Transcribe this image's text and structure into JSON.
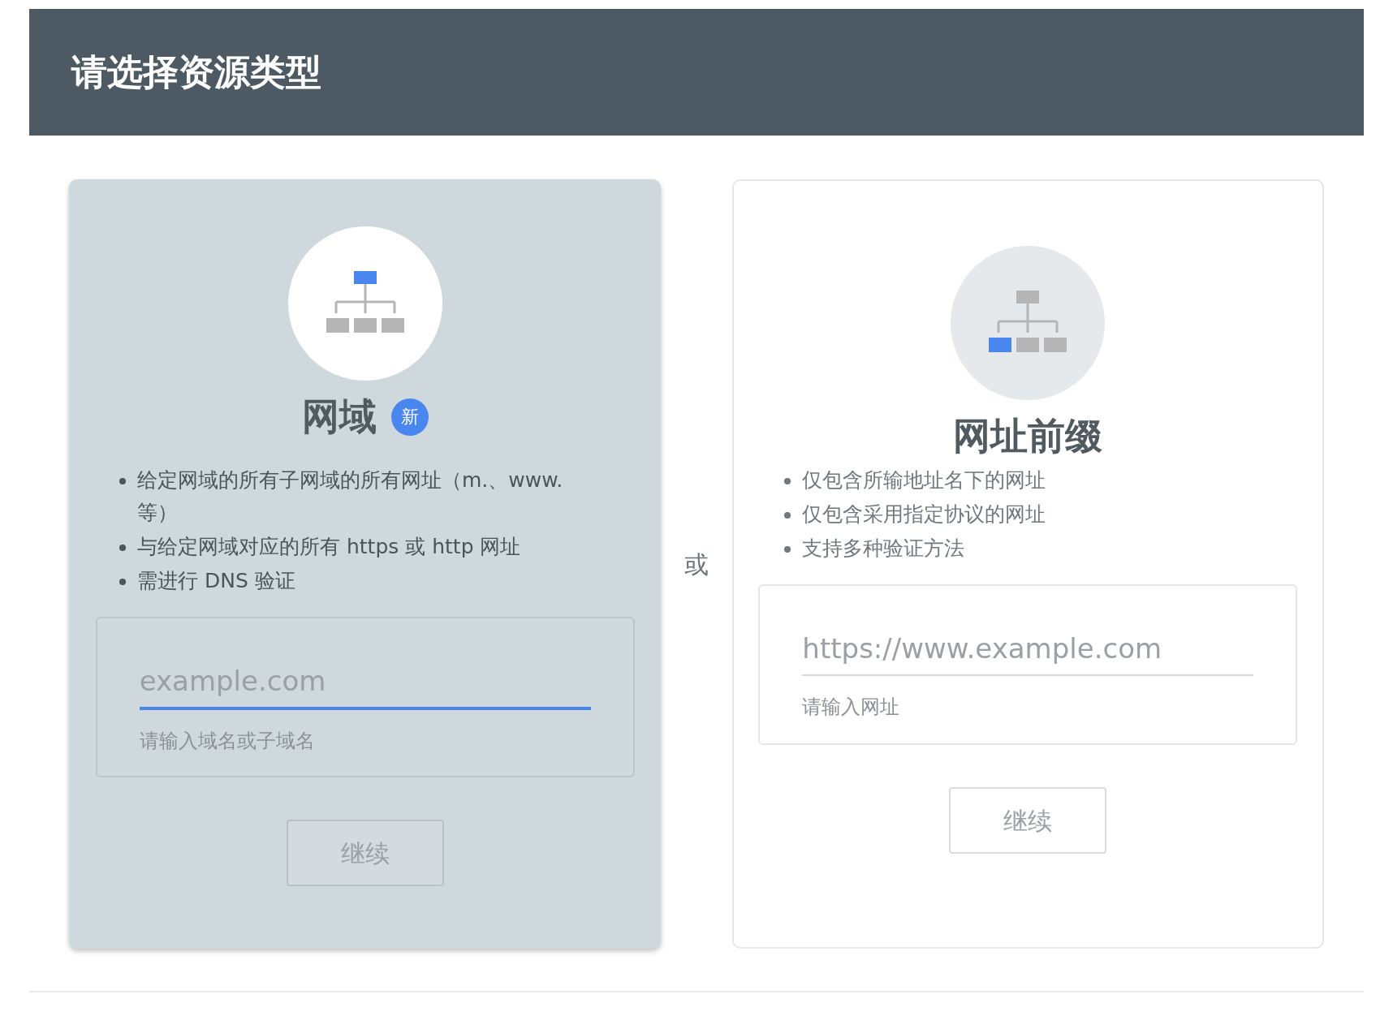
{
  "header": {
    "title": "请选择资源类型"
  },
  "separator": "或",
  "cards": [
    {
      "kind": "domain",
      "selected": true,
      "title": "网域",
      "badge": "新",
      "bullets": [
        "给定网域的所有子网域的所有网址（m.、www. 等）",
        "与给定网域对应的所有 https 或 http 网址",
        "需进行 DNS 验证"
      ],
      "input": {
        "placeholder": "example.com",
        "focused": true,
        "helper": "请输入域名或子域名"
      },
      "button": "继续"
    },
    {
      "kind": "prefix",
      "selected": false,
      "title": "网址前缀",
      "bullets": [
        "仅包含所输地址名下的网址",
        "仅包含采用指定协议的网址",
        "支持多种验证方法"
      ],
      "input": {
        "placeholder": "https://www.example.com",
        "focused": false,
        "helper": "请输入网址"
      },
      "button": "继续"
    }
  ]
}
